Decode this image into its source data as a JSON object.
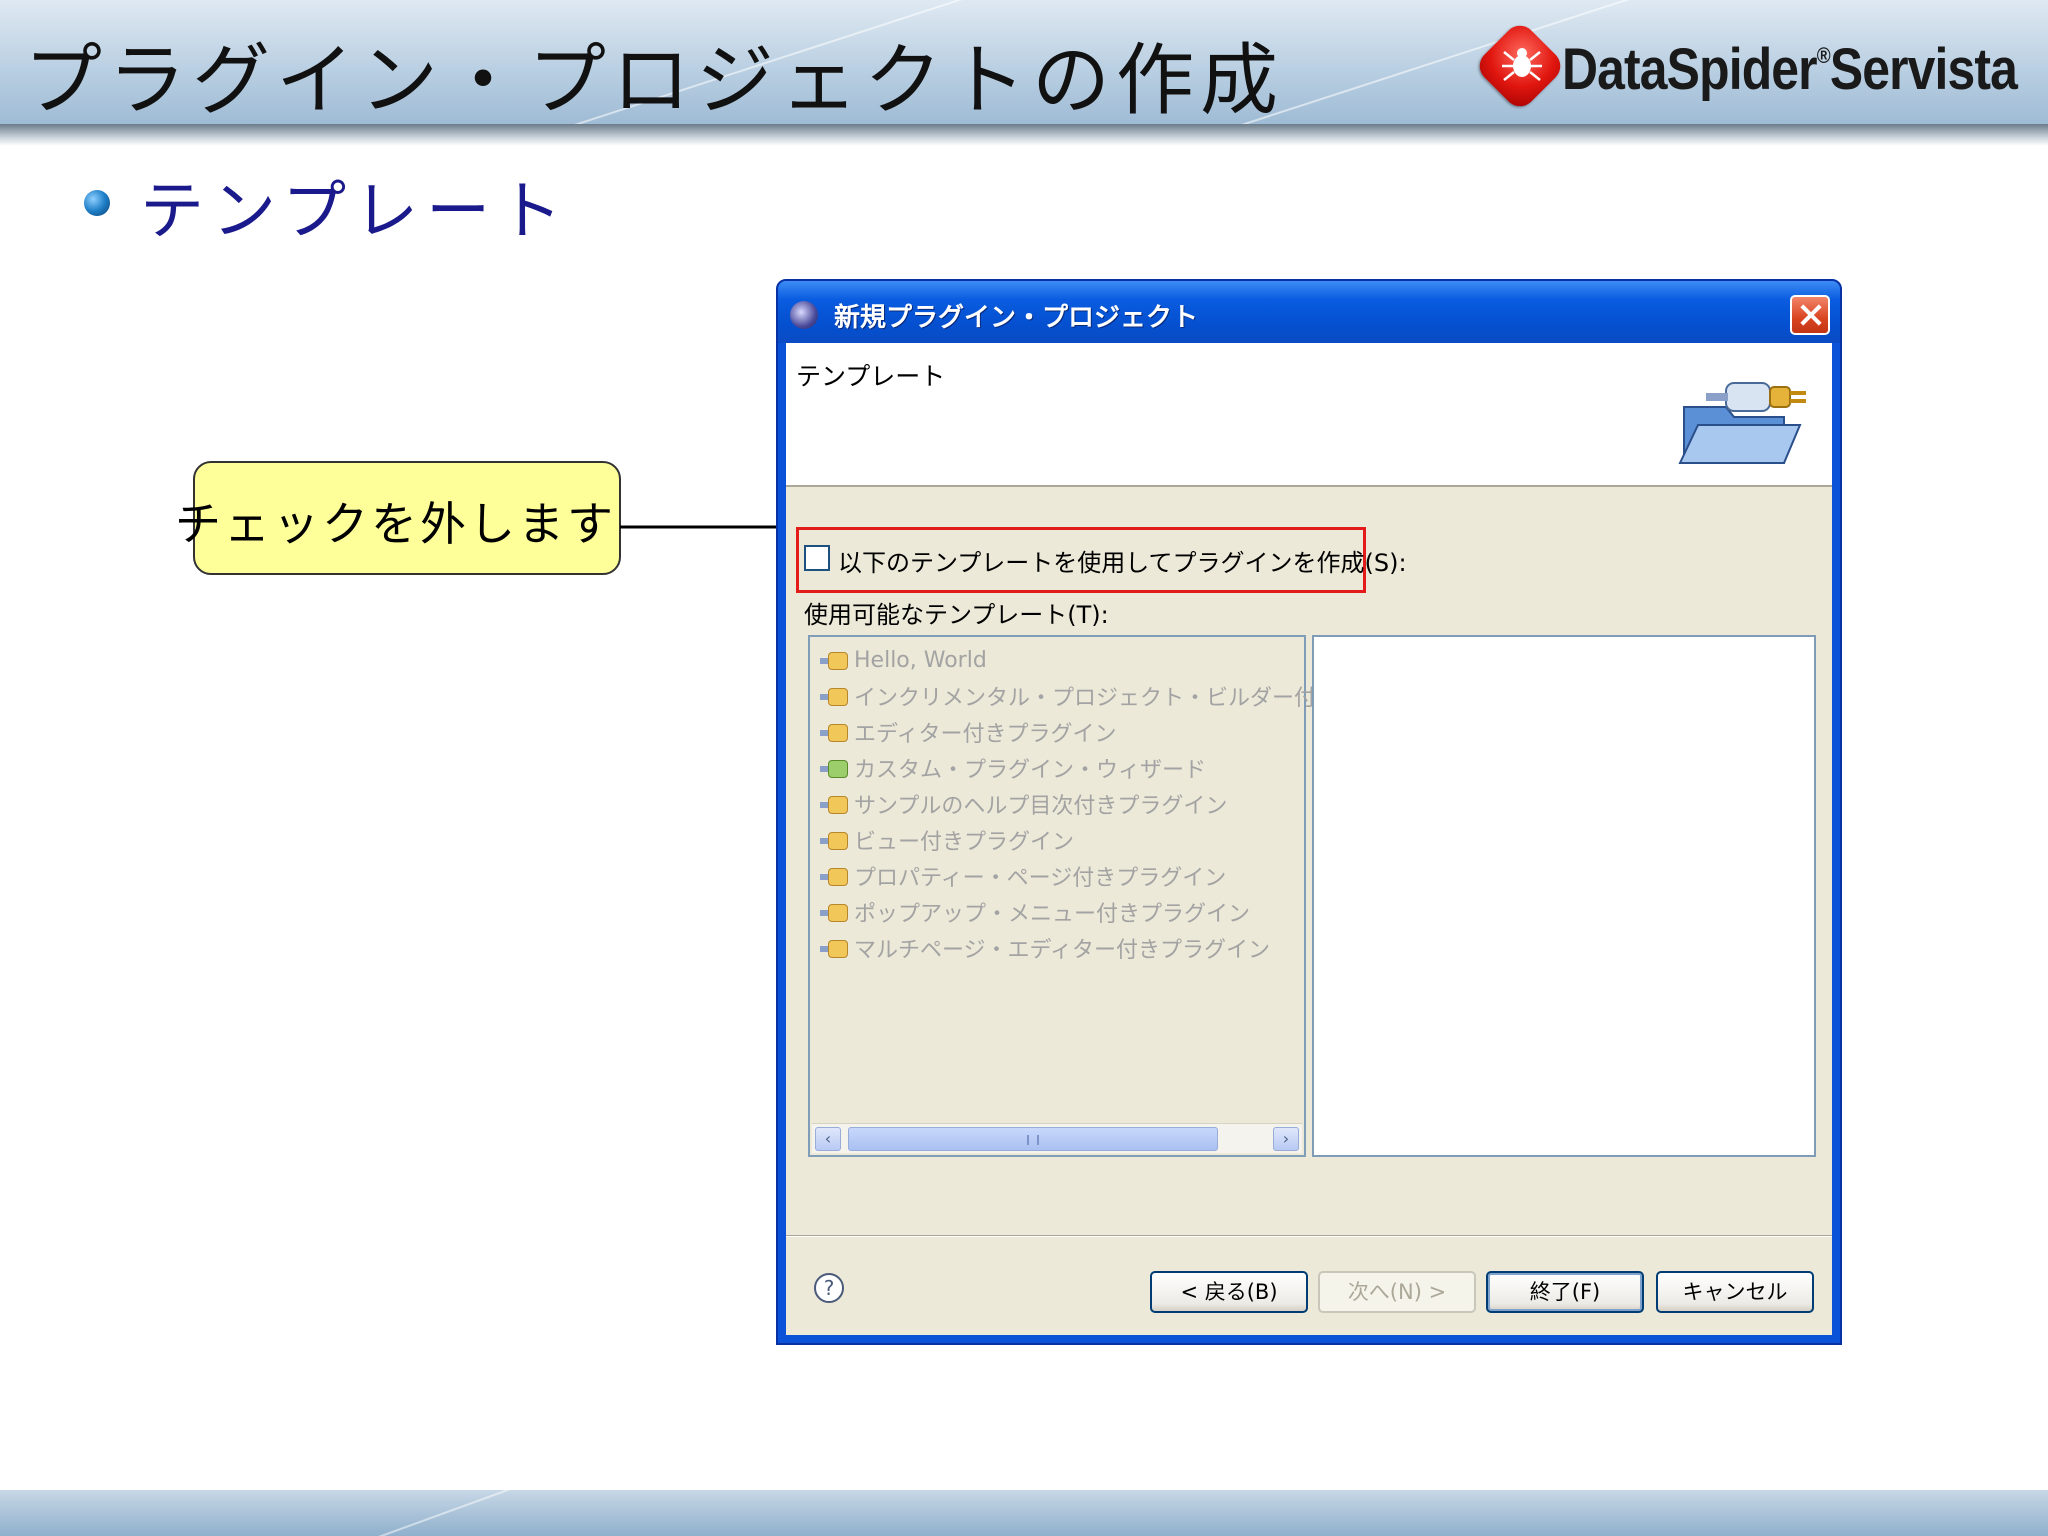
{
  "slide": {
    "title": "プラグイン・プロジェクトの作成",
    "brand": "DataSpider",
    "brand_reg": "®",
    "brand_suffix": "Servista",
    "bullet": "テンプレート"
  },
  "callout": {
    "text": "チェックを外します"
  },
  "dialog": {
    "title": "新規プラグイン・プロジェクト",
    "banner_title": "テンプレート",
    "checkbox_label": "以下のテンプレートを使用してプラグインを作成(S):",
    "checkbox_checked": false,
    "available_label": "使用可能なテンプレート(T):",
    "templates": [
      {
        "label": "Hello, World",
        "icon": "plugin-icon"
      },
      {
        "label": "インクリメンタル・プロジェクト・ビルダー付きプラ",
        "icon": "plugin-icon"
      },
      {
        "label": "エディター付きプラグイン",
        "icon": "plugin-icon"
      },
      {
        "label": "カスタム・プラグイン・ウィザード",
        "icon": "wizard-icon"
      },
      {
        "label": "サンプルのヘルプ目次付きプラグイン",
        "icon": "plugin-icon"
      },
      {
        "label": "ビュー付きプラグイン",
        "icon": "plugin-icon"
      },
      {
        "label": "プロパティー・ページ付きプラグイン",
        "icon": "plugin-icon"
      },
      {
        "label": "ポップアップ・メニュー付きプラグイン",
        "icon": "plugin-icon"
      },
      {
        "label": "マルチページ・エディター付きプラグイン",
        "icon": "plugin-icon"
      }
    ],
    "buttons": {
      "back": "< 戻る(B)",
      "next": "次へ(N) >",
      "finish": "終了(F)",
      "cancel": "キャンセル"
    },
    "help_icon_glyph": "?"
  }
}
